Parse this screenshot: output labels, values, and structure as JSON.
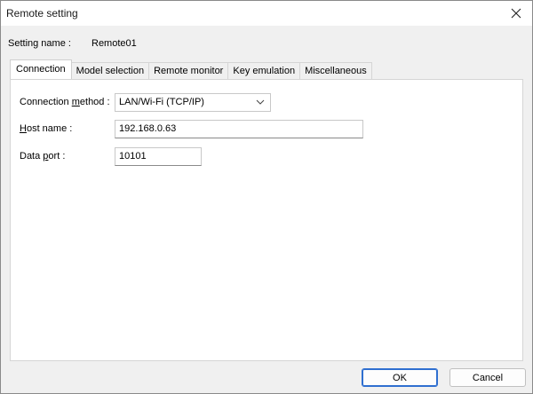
{
  "window": {
    "title": "Remote setting",
    "close_icon": "close-icon"
  },
  "setting": {
    "label": "Setting name :",
    "value": "Remote01"
  },
  "tabs": [
    {
      "label": "Connection",
      "active": true
    },
    {
      "label": "Model selection",
      "active": false
    },
    {
      "label": "Remote monitor",
      "active": false
    },
    {
      "label": "Key emulation",
      "active": false
    },
    {
      "label": "Miscellaneous",
      "active": false
    }
  ],
  "connection": {
    "method_label_pre": "Connection ",
    "method_label_ul": "m",
    "method_label_post": "ethod :",
    "method_value": "LAN/Wi-Fi (TCP/IP)",
    "host_label_ul": "H",
    "host_label_post": "ost name :",
    "host_value": "192.168.0.63",
    "port_label_pre": "Data ",
    "port_label_ul": "p",
    "port_label_post": "ort :",
    "port_value": "10101"
  },
  "buttons": {
    "ok": "OK",
    "cancel": "Cancel"
  },
  "colors": {
    "accent": "#2f6fd0",
    "dialog_bg": "#f0f0f0"
  }
}
